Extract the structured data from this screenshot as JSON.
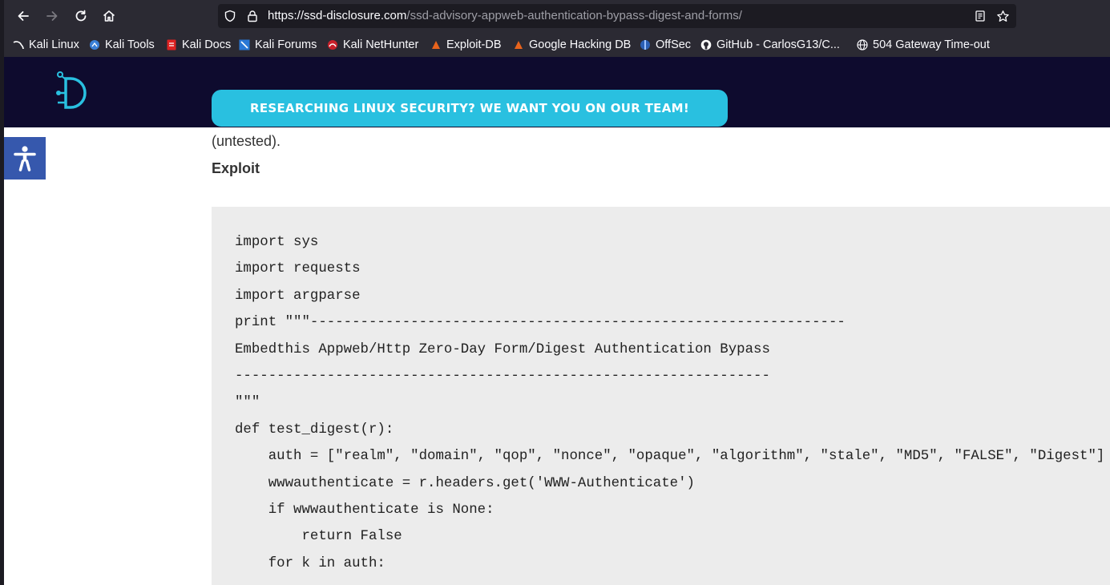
{
  "browser": {
    "url_domain": "https://ssd-disclosure.com",
    "url_path": "/ssd-advisory-appweb-authentication-bypass-digest-and-forms/",
    "bookmarks": [
      {
        "label": "Kali Linux",
        "icon": "kali-dragon-icon"
      },
      {
        "label": "Kali Tools",
        "icon": "kali-tools-icon"
      },
      {
        "label": "Kali Docs",
        "icon": "kali-docs-icon"
      },
      {
        "label": "Kali Forums",
        "icon": "kali-forums-icon"
      },
      {
        "label": "Kali NetHunter",
        "icon": "nethunter-icon"
      },
      {
        "label": "Exploit-DB",
        "icon": "exploit-db-icon"
      },
      {
        "label": "Google Hacking DB",
        "icon": "ghdb-icon"
      },
      {
        "label": "OffSec",
        "icon": "offsec-icon"
      },
      {
        "label": "GitHub - CarlosG13/C...",
        "icon": "github-icon"
      },
      {
        "label": "504 Gateway Time-out",
        "icon": "globe-icon"
      }
    ]
  },
  "site": {
    "cta_label": "RESEARCHING LINUX SECURITY? WE WANT YOU ON OUR TEAM!",
    "accent_color": "#29c0e0",
    "header_color": "#0e0b2e"
  },
  "content": {
    "untested_text": "(untested).",
    "exploit_heading": "Exploit",
    "code_lines": [
      "import sys",
      "import requests",
      "import argparse",
      "print \"\"\"----------------------------------------------------------------",
      "Embedthis Appweb/Http Zero-Day Form/Digest Authentication Bypass",
      "----------------------------------------------------------------",
      "\"\"\"",
      "def test_digest(r):",
      "    auth = [\"realm\", \"domain\", \"qop\", \"nonce\", \"opaque\", \"algorithm\", \"stale\", \"MD5\", \"FALSE\", \"Digest\"]",
      "    wwwauthenticate = r.headers.get('WWW-Authenticate')",
      "    if wwwauthenticate is None:",
      "        return False",
      "    for k in auth:"
    ]
  }
}
